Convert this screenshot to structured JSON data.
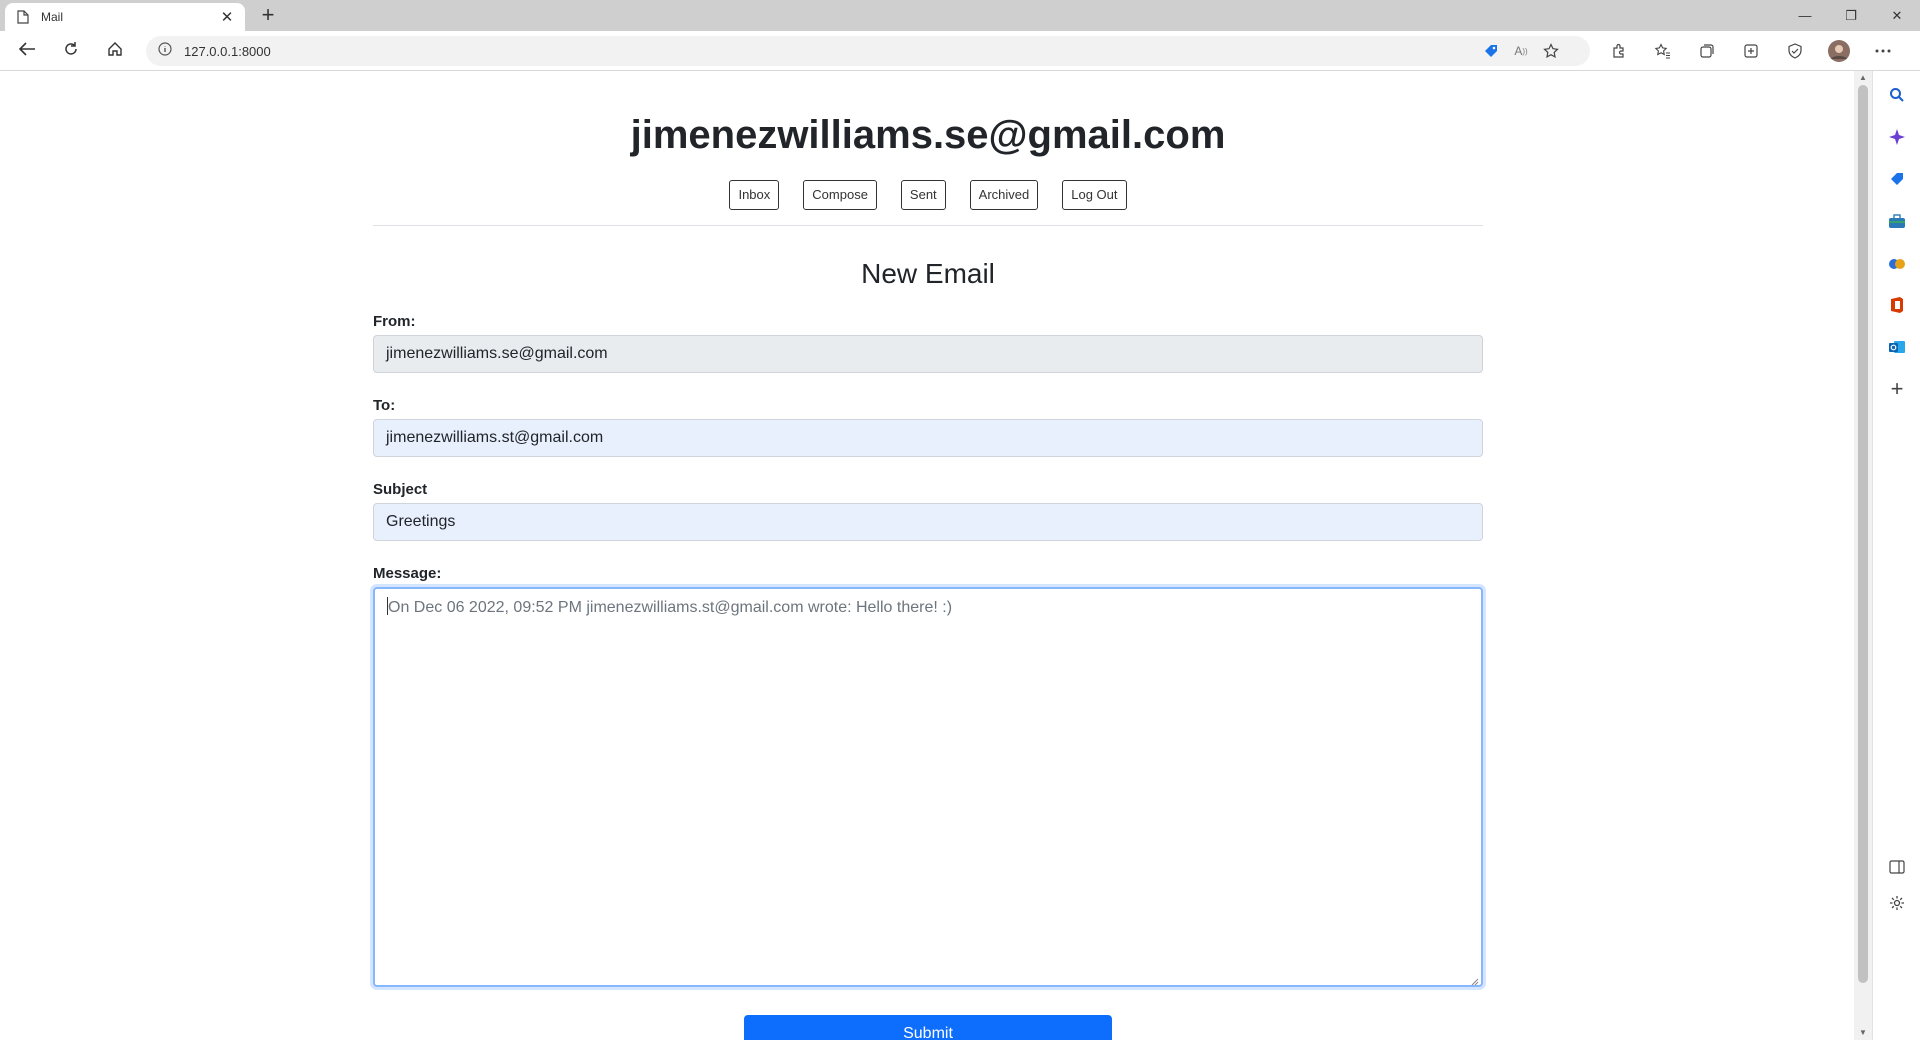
{
  "browser": {
    "tab_title": "Mail",
    "tab_close": "✕",
    "new_tab": "+",
    "url": "127.0.0.1:8000",
    "minimize": "—",
    "restore": "❐",
    "close": "✕"
  },
  "header": {
    "user_email": "jimenezwilliams.se@gmail.com"
  },
  "nav": {
    "inbox": "Inbox",
    "compose": "Compose",
    "sent": "Sent",
    "archived": "Archived",
    "logout": "Log Out"
  },
  "compose": {
    "title": "New Email",
    "from_label": "From:",
    "from_value": "jimenezwilliams.se@gmail.com",
    "to_label": "To:",
    "to_value": "jimenezwilliams.st@gmail.com",
    "subject_label": "Subject",
    "subject_value": "Greetings",
    "message_label": "Message:",
    "message_value": "On Dec 06 2022, 09:52 PM jimenezwilliams.st@gmail.com wrote: Hello there! :)",
    "submit_label": "Submit"
  },
  "colors": {
    "accent": "#0d6efd",
    "readonly_bg": "#e9ecef",
    "autofill_bg": "#e8f0fe"
  }
}
